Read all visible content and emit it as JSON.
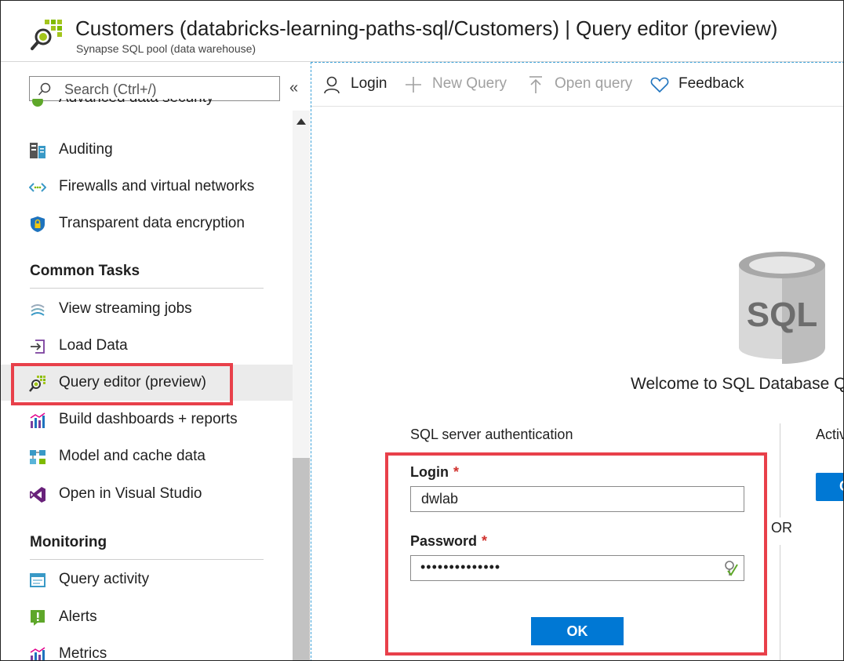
{
  "header": {
    "title": "Customers (databricks-learning-paths-sql/Customers) | Query editor (preview)",
    "subtitle": "Synapse SQL pool (data warehouse)"
  },
  "sidebar": {
    "search_placeholder": "Search (Ctrl+/)",
    "collapse_glyph": "«",
    "partial_item": "Advanced data security",
    "items_security": [
      {
        "label": "Auditing",
        "icon": "auditing-icon"
      },
      {
        "label": "Firewalls and virtual networks",
        "icon": "firewall-icon"
      },
      {
        "label": "Transparent data encryption",
        "icon": "shield-lock-icon"
      }
    ],
    "common_tasks": {
      "heading": "Common Tasks",
      "items": [
        {
          "label": "View streaming jobs",
          "icon": "streaming-jobs-icon"
        },
        {
          "label": "Load Data",
          "icon": "load-data-icon"
        },
        {
          "label": "Query editor (preview)",
          "icon": "query-editor-icon",
          "selected": true
        },
        {
          "label": "Build dashboards + reports",
          "icon": "dashboards-icon"
        },
        {
          "label": "Model and cache data",
          "icon": "model-cache-icon"
        },
        {
          "label": "Open in Visual Studio",
          "icon": "visual-studio-icon"
        }
      ]
    },
    "monitoring": {
      "heading": "Monitoring",
      "items": [
        {
          "label": "Query activity",
          "icon": "query-activity-icon"
        },
        {
          "label": "Alerts",
          "icon": "alerts-icon"
        },
        {
          "label": "Metrics",
          "icon": "metrics-icon"
        }
      ]
    }
  },
  "toolbar": {
    "login": "Login",
    "new_query": "New Query",
    "open_query": "Open query",
    "feedback": "Feedback"
  },
  "main": {
    "sql_icon_text": "SQL",
    "welcome": "Welcome to SQL Database Q",
    "auth_title": "SQL server authentication",
    "or_text": "OR",
    "active_partial": "Activ",
    "blue_button_partial": "C",
    "login_label": "Login",
    "login_value": "dwlab",
    "password_label": "Password",
    "password_mask": "••••••••••••••",
    "required_marker": "*",
    "ok_label": "OK"
  },
  "colors": {
    "accent_blue": "#0078d4",
    "highlight_red": "#e8404a",
    "required_red": "#d0312d",
    "selected_bg": "#ebebeb"
  }
}
